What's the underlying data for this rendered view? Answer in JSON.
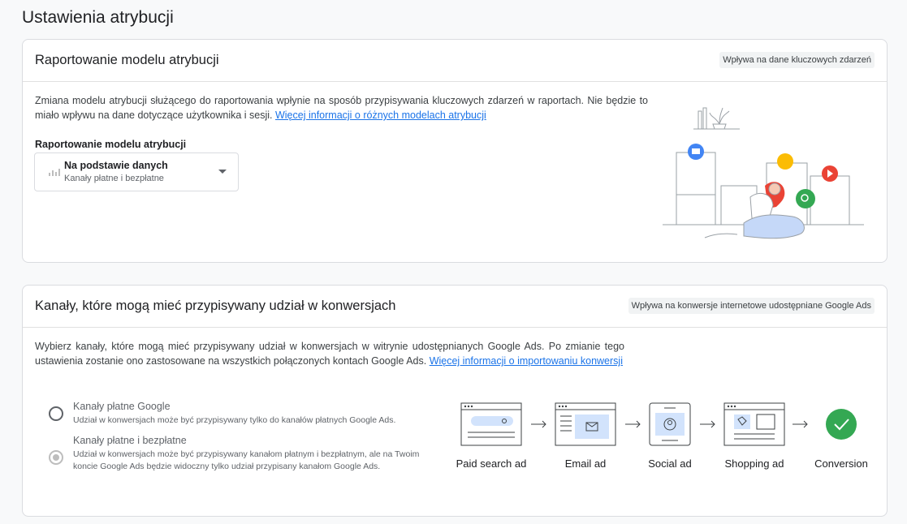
{
  "page": {
    "title": "Ustawienia atrybucji"
  },
  "reporting_card": {
    "title": "Raportowanie modelu atrybucji",
    "chip": "Wpływa na dane kluczowych zdarzeń",
    "description": "Zmiana modelu atrybucji służącego do raportowania wpłynie na sposób przypisywania kluczowych zdarzeń w raportach. Nie będzie to miało wpływu na dane dotyczące użytkownika i sesji. ",
    "link": "Więcej informacji o różnych modelach atrybucji",
    "field_label": "Raportowanie modelu atrybucji",
    "select": {
      "value": "Na podstawie danych",
      "subvalue": "Kanały płatne i bezpłatne",
      "icon": "bar-chart-icon"
    }
  },
  "channels_card": {
    "title": "Kanały, które mogą mieć przypisywany udział w konwersjach",
    "chip": "Wpływa na konwersje internetowe udostępniane Google Ads",
    "description": "Wybierz kanały, które mogą mieć przypisywany udział w konwersjach w witrynie udostępnianych Google Ads. Po zmianie tego ustawienia zostanie ono zastosowane na wszystkich połączonych kontach Google Ads. ",
    "link": "Więcej informacji o importowaniu konwersji",
    "options": [
      {
        "title": "Kanały płatne Google",
        "desc": "Udział w konwersjach może być przypisywany tylko do kanałów płatnych Google Ads."
      },
      {
        "title": "Kanały płatne i bezpłatne",
        "desc": "Udział w konwersjach może być przypisywany kanałom płatnym i bezpłatnym, ale na Twoim koncie Google Ads będzie widoczny tylko udział przypisany kanałom Google Ads."
      }
    ],
    "flow": [
      "Paid search ad",
      "Email ad",
      "Social ad",
      "Shopping ad",
      "Conversion"
    ]
  },
  "colors": {
    "link": "#1a73e8",
    "conversion": "#34a853",
    "illustration_red": "#ea4335",
    "illustration_blue": "#4285f4",
    "illustration_yellow": "#fbbc04"
  }
}
